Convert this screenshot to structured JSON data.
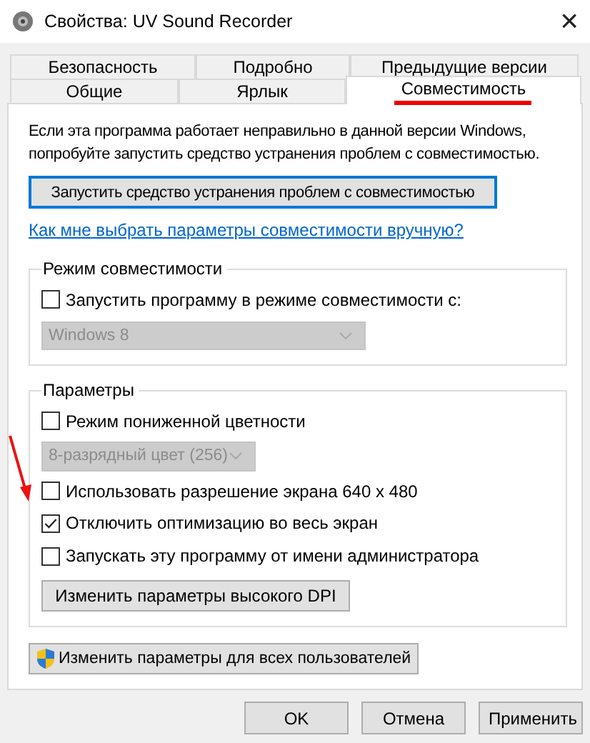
{
  "window": {
    "title": "Свойства: UV Sound Recorder",
    "close": "×"
  },
  "tab_rows": [
    [
      {
        "label": "Безопасность",
        "selected": false
      },
      {
        "label": "Подробно",
        "selected": false
      },
      {
        "label": "Предыдущие версии",
        "selected": false
      }
    ],
    [
      {
        "label": "Общие",
        "selected": false
      },
      {
        "label": "Ярлык",
        "selected": false
      },
      {
        "label": "Совместимость",
        "selected": true
      }
    ]
  ],
  "intro": "Если эта программа работает неправильно в данной версии Windows, попробуйте запустить средство устранения проблем с совместимостью.",
  "troubleshoot_button": "Запустить средство устранения проблем с совместимостью",
  "manual_link": "Как мне выбрать параметры совместимости вручную?",
  "compat_group": {
    "title": "Режим совместимости",
    "items": [
      {
        "kind": "checkbox",
        "label": "Запустить программу в режиме совместимости с:",
        "checked": false
      },
      {
        "kind": "dropdown",
        "value": "Windows 8",
        "disabled": true
      }
    ]
  },
  "settings_group": {
    "title": "Параметры",
    "items": [
      {
        "kind": "checkbox",
        "label": "Режим пониженной цветности",
        "checked": false
      },
      {
        "kind": "dropdown",
        "value": "8-разрядный цвет (256)",
        "disabled": true
      },
      {
        "kind": "checkbox",
        "label": "Использовать разрешение экрана 640 x 480",
        "checked": false
      },
      {
        "kind": "checkbox",
        "label": "Отключить оптимизацию во весь экран",
        "checked": true
      },
      {
        "kind": "checkbox",
        "label": "Запускать эту программу от имени администратора",
        "checked": false
      },
      {
        "kind": "button",
        "label": "Изменить параметры высокого DPI"
      }
    ]
  },
  "all_users_button": "Изменить параметры для всех пользователей",
  "buttons": [
    "OK",
    "Отмена",
    "Применить"
  ]
}
